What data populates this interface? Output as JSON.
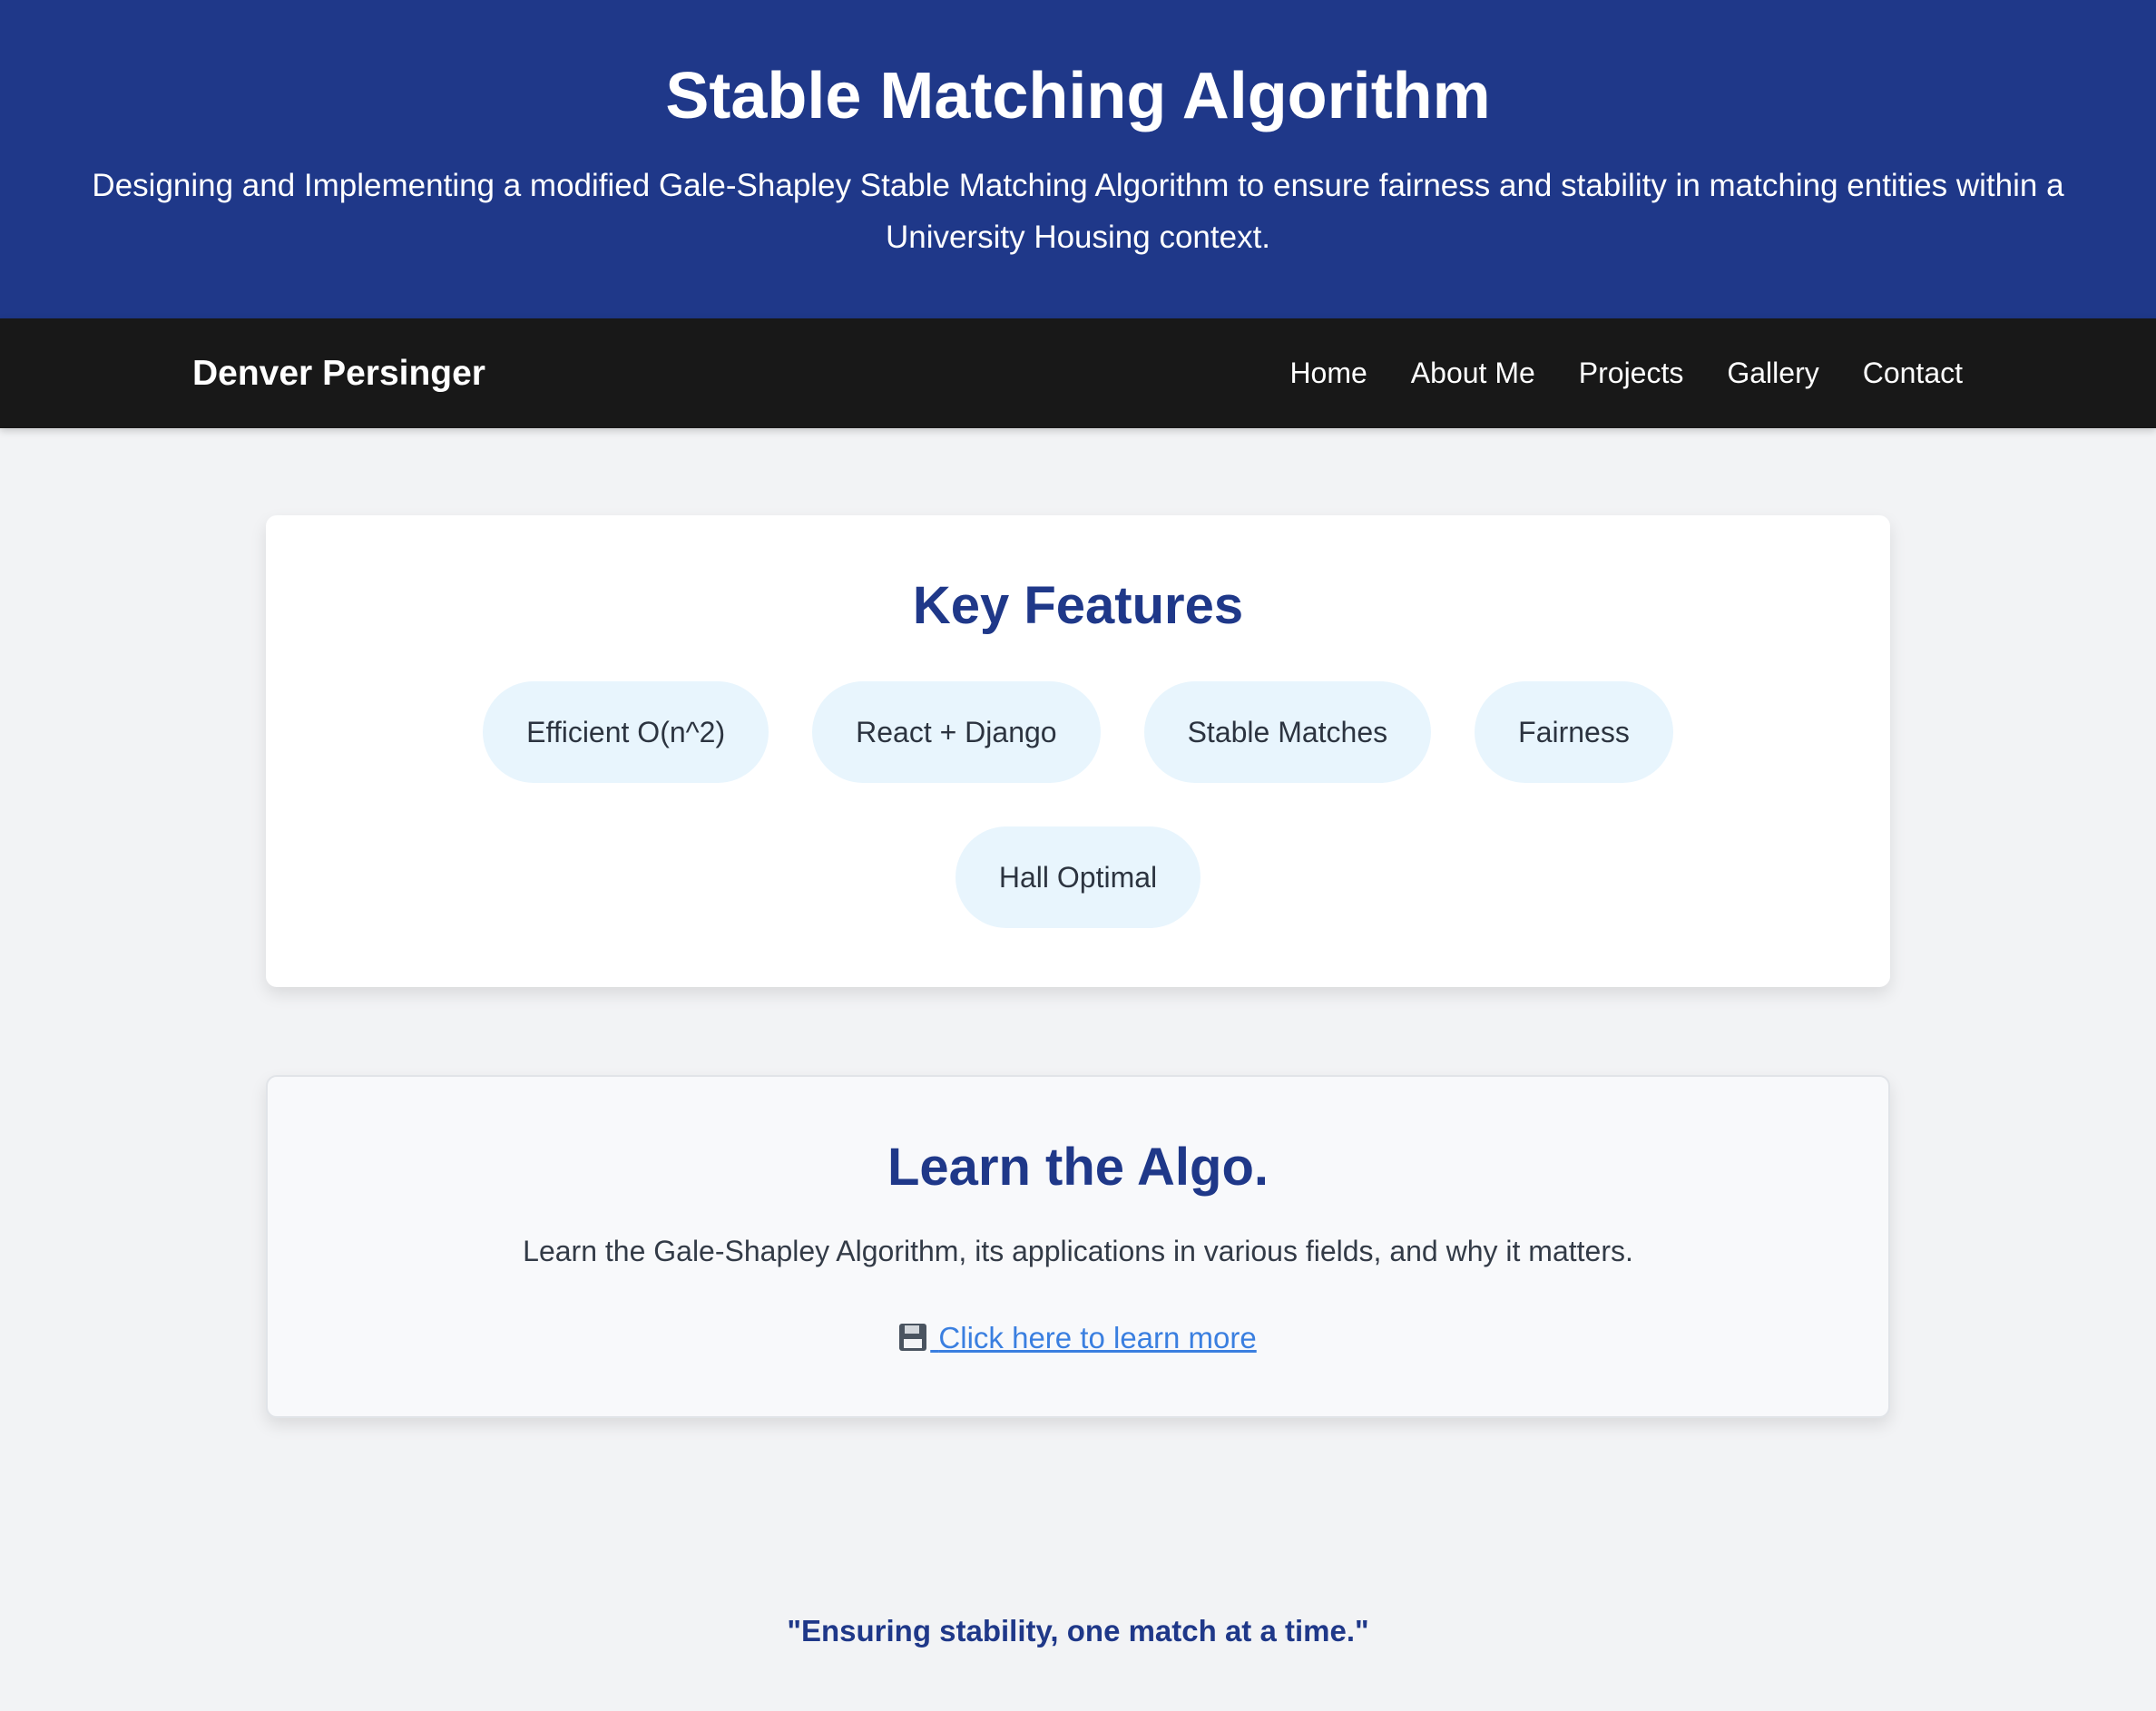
{
  "hero": {
    "title": "Stable Matching Algorithm",
    "subtitle": "Designing and Implementing a modified Gale-Shapley Stable Matching Algorithm to ensure fairness and stability in matching entities within a University Housing context."
  },
  "nav": {
    "brand": "Denver Persinger",
    "links": [
      "Home",
      "About Me",
      "Projects",
      "Gallery",
      "Contact"
    ]
  },
  "features": {
    "title": "Key Features",
    "items": [
      "Efficient O(n^2)",
      "React + Django",
      "Stable Matches",
      "Fairness",
      "Hall Optimal"
    ]
  },
  "learn": {
    "title": "Learn the Algo.",
    "description": "Learn the Gale-Shapley Algorithm, its applications in various fields, and why it matters.",
    "link_icon": "floppy-disk-icon",
    "link_label": "Click here to learn more"
  },
  "footer": {
    "quote": "\"Ensuring stability, one match at a time.\""
  },
  "colors": {
    "hero_bg": "#1f3889",
    "nav_bg": "#181818",
    "page_bg": "#f2f3f5",
    "accent_title": "#1f3889",
    "pill_bg": "#e8f5fd",
    "link": "#3a7fe0"
  }
}
